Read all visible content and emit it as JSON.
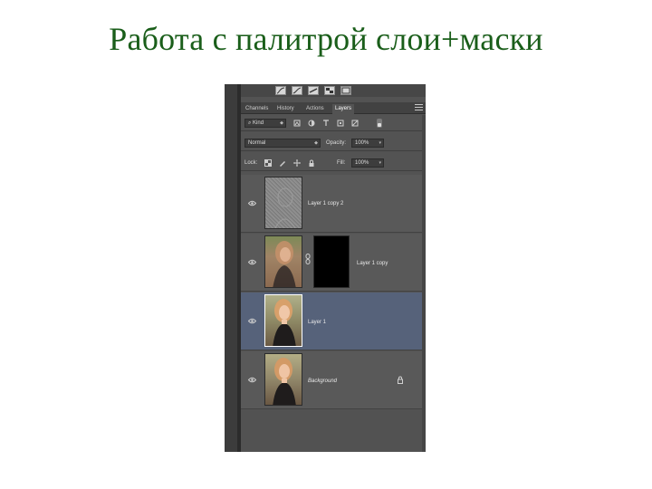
{
  "slide": {
    "title": "Работа с палитрой слои+маски"
  },
  "panel": {
    "tabs": [
      {
        "label": "Channels",
        "active": false
      },
      {
        "label": "History",
        "active": false
      },
      {
        "label": "Actions",
        "active": false
      },
      {
        "label": "Layers",
        "active": true
      }
    ],
    "filter": {
      "value": "Kind"
    },
    "blend_mode": {
      "value": "Normal"
    },
    "opacity": {
      "label": "Opacity:",
      "value": "100%"
    },
    "lock": {
      "label": "Lock:"
    },
    "fill": {
      "label": "Fill:",
      "value": "100%"
    },
    "layers": [
      {
        "name": "Layer 1 copy 2",
        "thumb": "texture",
        "has_mask": false,
        "selected": false,
        "italic": false,
        "locked": false
      },
      {
        "name": "Layer 1 copy",
        "thumb": "photo-blur",
        "has_mask": true,
        "selected": false,
        "italic": false,
        "locked": false
      },
      {
        "name": "Layer 1",
        "thumb": "photo",
        "has_mask": false,
        "selected": true,
        "italic": false,
        "locked": false
      },
      {
        "name": "Background",
        "thumb": "photo",
        "has_mask": false,
        "selected": false,
        "italic": true,
        "locked": true
      }
    ],
    "icons": {
      "top_row": [
        "curves-icon",
        "curves-icon",
        "gradient-map-icon",
        "selective-color-icon",
        "photo-filter-icon"
      ],
      "filter_row": [
        "pixel-filter-icon",
        "adjustment-filter-icon",
        "type-filter-icon",
        "shape-filter-icon",
        "smart-object-filter-icon",
        "filter-toggle-icon"
      ],
      "lock_row": [
        "lock-transparent-icon",
        "lock-image-icon",
        "lock-position-icon",
        "lock-all-icon"
      ]
    },
    "colors": {
      "panel": "#535353",
      "selected_layer": "#56627a",
      "title": "#1a5e1a"
    }
  }
}
